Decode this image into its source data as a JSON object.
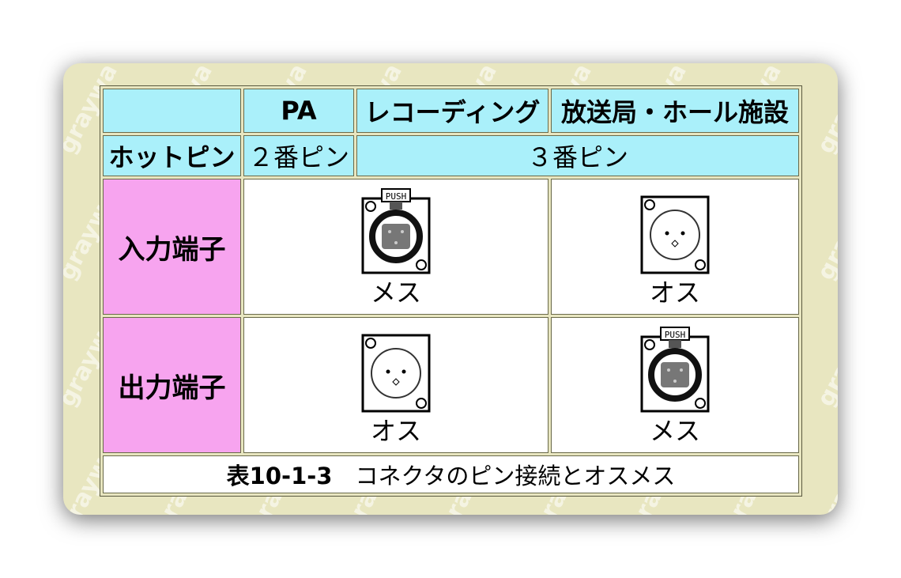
{
  "table": {
    "headers": [
      "",
      "PA",
      "レコーディング",
      "放送局・ホール施設"
    ],
    "hot_pin_label": "ホットピン",
    "hot_pin_pa": "２番ピン",
    "hot_pin_other": "３番ピン",
    "rows": [
      {
        "label": "入力端子",
        "cells": [
          {
            "connector": "female-xlr-connector",
            "push_label": "PUSH",
            "gender": "メス"
          },
          {
            "connector": "male-xlr-connector",
            "gender": "オス"
          }
        ]
      },
      {
        "label": "出力端子",
        "cells": [
          {
            "connector": "male-xlr-connector",
            "gender": "オス"
          },
          {
            "connector": "female-xlr-connector",
            "push_label": "PUSH",
            "gender": "メス"
          }
        ]
      }
    ],
    "caption_number": "表10-1-3",
    "caption_text": "コネクタのピン接続とオスメス"
  },
  "watermark": "graywa",
  "colors": {
    "card_background": "#e8e6c0",
    "header_cyan": "#aaf0fa",
    "row_label_pink": "#f7a4ef"
  }
}
